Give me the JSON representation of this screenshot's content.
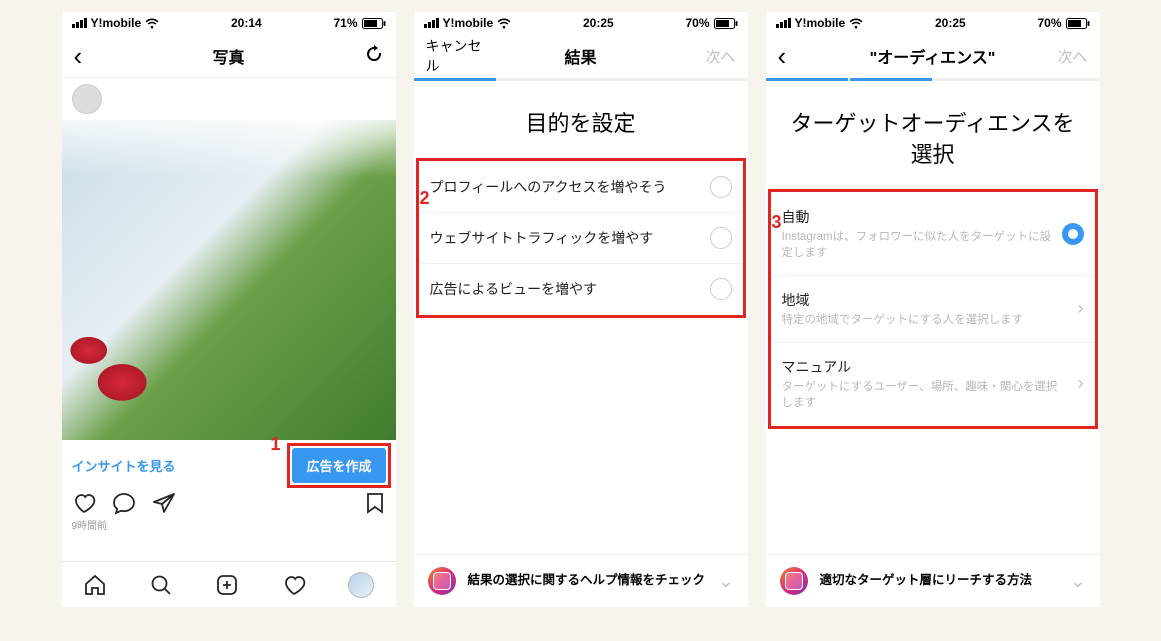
{
  "annotations": {
    "step1": "1",
    "step2": "2",
    "step3": "3"
  },
  "screen1": {
    "status": {
      "carrier": "Y!mobile",
      "time": "20:14",
      "battery": "71%"
    },
    "nav": {
      "title": "写真"
    },
    "insights_link": "インサイトを見る",
    "promote_button": "広告を作成",
    "time_ago": "9時間前"
  },
  "screen2": {
    "status": {
      "carrier": "Y!mobile",
      "time": "20:25",
      "battery": "70%"
    },
    "nav": {
      "left": "キャンセル",
      "title": "結果",
      "right": "次へ"
    },
    "heading": "目的を設定",
    "options": [
      {
        "label": "プロフィールへのアクセスを増やそう"
      },
      {
        "label": "ウェブサイトトラフィックを増やす"
      },
      {
        "label": "広告によるビューを増やす"
      }
    ],
    "help": "結果の選択に関するヘルプ情報をチェック"
  },
  "screen3": {
    "status": {
      "carrier": "Y!mobile",
      "time": "20:25",
      "battery": "70%"
    },
    "nav": {
      "title": "\"オーディエンス\"",
      "right": "次へ"
    },
    "heading": "ターゲットオーディエンスを選択",
    "options": [
      {
        "title": "自動",
        "sub": "Instagramは、フォロワーに似た人をターゲットに設定します",
        "selected": true
      },
      {
        "title": "地域",
        "sub": "特定の地域でターゲットにする人を選択します",
        "arrow": true
      },
      {
        "title": "マニュアル",
        "sub": "ターゲットにするユーザー、場所、趣味・関心を選択します",
        "arrow": true
      }
    ],
    "help": "適切なターゲット層にリーチする方法"
  }
}
